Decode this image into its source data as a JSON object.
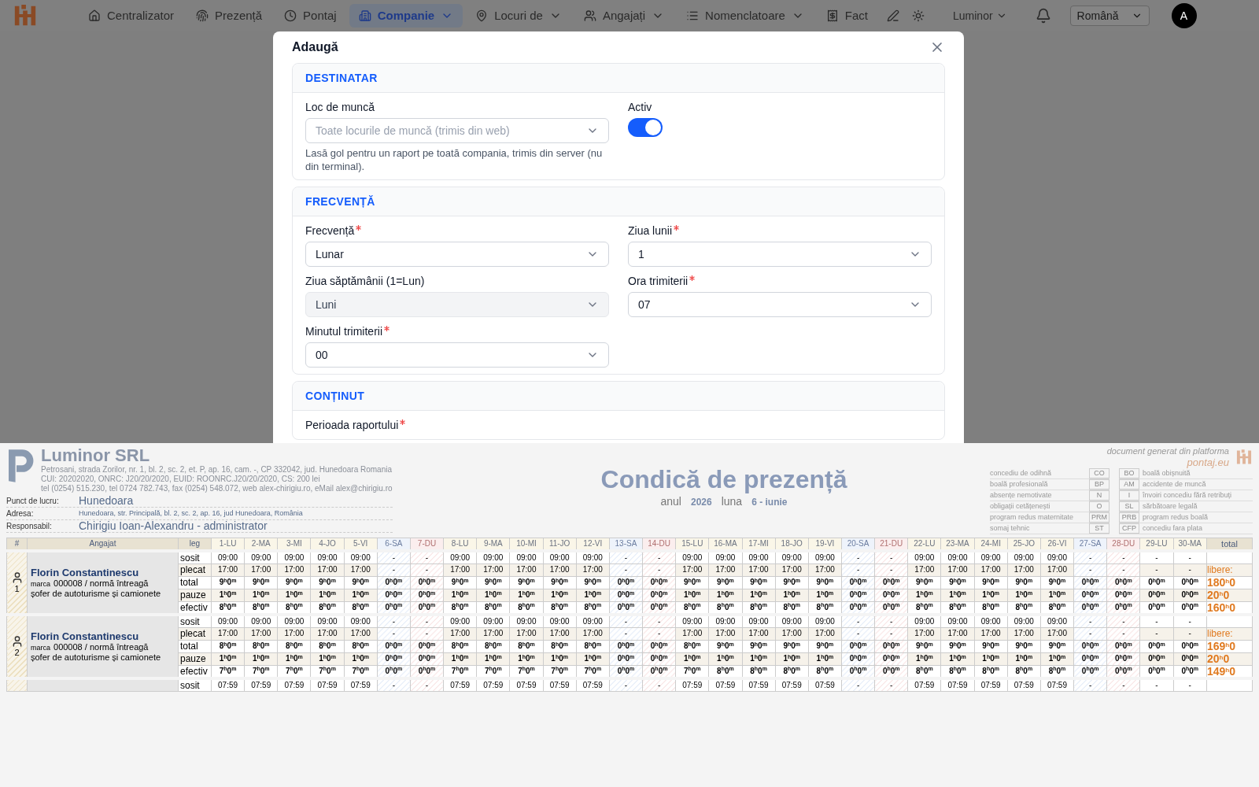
{
  "nav": {
    "items": [
      {
        "label": "Centralizator",
        "selected": false,
        "menu": false
      },
      {
        "label": "Prezență",
        "selected": false,
        "menu": false
      },
      {
        "label": "Pontaj",
        "selected": false,
        "menu": false
      },
      {
        "label": "Companie",
        "selected": true,
        "menu": true
      },
      {
        "label": "Locuri de",
        "selected": false,
        "menu": true
      },
      {
        "label": "Angajați",
        "selected": false,
        "menu": true
      },
      {
        "label": "Nomenclatoare",
        "selected": false,
        "menu": true
      },
      {
        "label": "Fact",
        "selected": false,
        "menu": false
      }
    ],
    "company": "Luminor",
    "language": "Română",
    "avatar": "A"
  },
  "modal": {
    "title": "Adaugă",
    "sections": [
      {
        "title": "DESTINATAR",
        "fields": [
          {
            "kind": "select",
            "label": "Loc de muncă",
            "required": false,
            "disabled": false,
            "placeholder": "Toate locurile de muncă (trimis din web)",
            "help": "Lasă gol pentru un raport pe toată compania, trimis din server (nu din terminal)."
          },
          {
            "kind": "toggle",
            "label": "Activ",
            "on": true
          }
        ]
      },
      {
        "title": "FRECVENȚĂ",
        "fields": [
          {
            "kind": "select",
            "label": "Frecvență",
            "required": true,
            "disabled": false,
            "value": "Lunar"
          },
          {
            "kind": "select",
            "label": "Ziua lunii",
            "required": true,
            "disabled": false,
            "value": "1"
          },
          {
            "kind": "select",
            "label": "Ziua săptămânii (1=Lun)",
            "required": false,
            "disabled": true,
            "value": "Luni"
          },
          {
            "kind": "select",
            "label": "Ora trimiterii",
            "required": true,
            "disabled": false,
            "value": "07"
          },
          {
            "kind": "select",
            "label": "Minutul trimiterii",
            "required": true,
            "disabled": false,
            "value": "00"
          }
        ]
      },
      {
        "title": "CONȚINUT",
        "fields": [
          {
            "kind": "label",
            "label": "Perioada raportului",
            "required": true
          }
        ]
      }
    ]
  },
  "document": {
    "company": {
      "name": "Luminor SRL",
      "lines": [
        "Petrosani, strada Zorilor, nr. 1, bl. 2, sc. 2, et. P, ap. 16, cam. -, CP 332042, jud. Hunedoara Romania",
        "CUI: 20202020, ONRC: J20/20/2020, EUID: ROONRC.J20/20/2020, CS: 200 lei",
        "tel (0254) 515.230, tel 0724 782.743, fax (0254) 548.072, web alex-chirigiu.ro, eMail alex@chirigiu.ro"
      ]
    },
    "info": [
      {
        "label": "Punct de lucru:",
        "value": "Hunedoara",
        "small": false
      },
      {
        "label": "Adresa:",
        "value": "Hunedoara, str. Principală, bl. 2, sc. 2, ap. 16, jud Hunedoara, România",
        "small": true
      },
      {
        "label": "Responsabil:",
        "value": "Chirigiu Ioan-Alexandru - administrator",
        "small": false
      }
    ],
    "title": "Condică de prezență",
    "year_label": "anul",
    "year": "2026",
    "month_label": "luna",
    "month": "6 - iunie",
    "platform_note": "document generat din platforma",
    "platform": "pontaj.eu",
    "legend_left": [
      {
        "label": "concediu de odihnă",
        "code": "CO"
      },
      {
        "label": "boală profesională",
        "code": "BP"
      },
      {
        "label": "absențe nemotivate",
        "code": "N"
      },
      {
        "label": "obligații cetățenești",
        "code": "O"
      },
      {
        "label": "program redus maternitate",
        "code": "PRM"
      },
      {
        "label": "somaj tehnic",
        "code": "ST"
      }
    ],
    "legend_right": [
      {
        "label": "boală obișnuită",
        "code": "BO"
      },
      {
        "label": "accidente de muncă",
        "code": "AM"
      },
      {
        "label": "învoiri concediu fără retribuți",
        "code": "I"
      },
      {
        "label": "sărbătoare legală",
        "code": "SL"
      },
      {
        "label": "program redus boală",
        "code": "PRB"
      },
      {
        "label": "concediu fara plata",
        "code": "CFP"
      }
    ]
  },
  "table": {
    "col_number": "#",
    "col_employee": "Angajat",
    "col_leg": "leg",
    "col_total": "total",
    "days": [
      {
        "label": "1-LU",
        "kind": "work"
      },
      {
        "label": "2-MA",
        "kind": "work"
      },
      {
        "label": "3-MI",
        "kind": "work"
      },
      {
        "label": "4-JO",
        "kind": "work"
      },
      {
        "label": "5-VI",
        "kind": "work"
      },
      {
        "label": "6-SA",
        "kind": "saturday"
      },
      {
        "label": "7-DU",
        "kind": "sunday"
      },
      {
        "label": "8-LU",
        "kind": "work"
      },
      {
        "label": "9-MA",
        "kind": "work"
      },
      {
        "label": "10-MI",
        "kind": "work"
      },
      {
        "label": "11-JO",
        "kind": "work"
      },
      {
        "label": "12-VI",
        "kind": "work"
      },
      {
        "label": "13-SA",
        "kind": "saturday"
      },
      {
        "label": "14-DU",
        "kind": "sunday"
      },
      {
        "label": "15-LU",
        "kind": "work"
      },
      {
        "label": "16-MA",
        "kind": "work"
      },
      {
        "label": "17-MI",
        "kind": "work"
      },
      {
        "label": "18-JO",
        "kind": "work"
      },
      {
        "label": "19-VI",
        "kind": "work"
      },
      {
        "label": "20-SA",
        "kind": "saturday"
      },
      {
        "label": "21-DU",
        "kind": "sunday"
      },
      {
        "label": "22-LU",
        "kind": "work"
      },
      {
        "label": "23-MA",
        "kind": "work"
      },
      {
        "label": "24-MI",
        "kind": "work"
      },
      {
        "label": "25-JO",
        "kind": "work"
      },
      {
        "label": "26-VI",
        "kind": "work"
      },
      {
        "label": "27-SA",
        "kind": "saturday"
      },
      {
        "label": "28-DU",
        "kind": "sunday"
      },
      {
        "label": "29-LU",
        "kind": "work"
      },
      {
        "label": "30-MA",
        "kind": "work"
      }
    ],
    "employees": [
      {
        "number": "1",
        "name": "Florin Constantinescu",
        "marca_label": "marca",
        "marca": "000008 / normă întreagă",
        "job": "șofer de autoturisme și camionete",
        "legs": [
          {
            "label": "sosit",
            "kind": "time",
            "values": [
              "09:00",
              "09:00",
              "09:00",
              "09:00",
              "09:00",
              "-",
              "-",
              "09:00",
              "09:00",
              "09:00",
              "09:00",
              "09:00",
              "-",
              "-",
              "09:00",
              "09:00",
              "09:00",
              "09:00",
              "09:00",
              "-",
              "-",
              "09:00",
              "09:00",
              "09:00",
              "09:00",
              "09:00",
              "-",
              "-",
              "-",
              "-"
            ]
          },
          {
            "label": "plecat",
            "kind": "time",
            "values": [
              "17:00",
              "17:00",
              "17:00",
              "17:00",
              "17:00",
              "-",
              "-",
              "17:00",
              "17:00",
              "17:00",
              "17:00",
              "17:00",
              "-",
              "-",
              "17:00",
              "17:00",
              "17:00",
              "17:00",
              "17:00",
              "-",
              "-",
              "17:00",
              "17:00",
              "17:00",
              "17:00",
              "17:00",
              "-",
              "-",
              "-",
              "-"
            ],
            "total": "libere:"
          },
          {
            "label": "total",
            "kind": "duration",
            "values": [
              "9$^{h}$0$^{m}$",
              "9$^{h}$0$^{m}$",
              "9$^{h}$0$^{m}$",
              "9$^{h}$0$^{m}$",
              "9$^{h}$0$^{m}$",
              "0$^{h}$0$^{m}$",
              "0$^{h}$0$^{m}$",
              "9$^{h}$0$^{m}$",
              "9$^{h}$0$^{m}$",
              "9$^{h}$0$^{m}$",
              "9$^{h}$0$^{m}$",
              "9$^{h}$0$^{m}$",
              "0$^{h}$0$^{m}$",
              "0$^{h}$0$^{m}$",
              "9$^{h}$0$^{m}$",
              "9$^{h}$0$^{m}$",
              "9$^{h}$0$^{m}$",
              "9$^{h}$0$^{m}$",
              "9$^{h}$0$^{m}$",
              "0$^{h}$0$^{m}$",
              "0$^{h}$0$^{m}$",
              "9$^{h}$0$^{m}$",
              "9$^{h}$0$^{m}$",
              "9$^{h}$0$^{m}$",
              "9$^{h}$0$^{m}$",
              "9$^{h}$0$^{m}$",
              "0$^{h}$0$^{m}$",
              "0$^{h}$0$^{m}$",
              "0$^{h}$0$^{m}$",
              "0$^{h}$0$^{m}$"
            ],
            "total": "180$^{h}$0"
          },
          {
            "label": "pauze",
            "kind": "duration",
            "values": [
              "1$^{h}$0$^{m}$",
              "1$^{h}$0$^{m}$",
              "1$^{h}$0$^{m}$",
              "1$^{h}$0$^{m}$",
              "1$^{h}$0$^{m}$",
              "0$^{h}$0$^{m}$",
              "0$^{h}$0$^{m}$",
              "1$^{h}$0$^{m}$",
              "1$^{h}$0$^{m}$",
              "1$^{h}$0$^{m}$",
              "1$^{h}$0$^{m}$",
              "1$^{h}$0$^{m}$",
              "0$^{h}$0$^{m}$",
              "0$^{h}$0$^{m}$",
              "1$^{h}$0$^{m}$",
              "1$^{h}$0$^{m}$",
              "1$^{h}$0$^{m}$",
              "1$^{h}$0$^{m}$",
              "1$^{h}$0$^{m}$",
              "0$^{h}$0$^{m}$",
              "0$^{h}$0$^{m}$",
              "1$^{h}$0$^{m}$",
              "1$^{h}$0$^{m}$",
              "1$^{h}$0$^{m}$",
              "1$^{h}$0$^{m}$",
              "1$^{h}$0$^{m}$",
              "0$^{h}$0$^{m}$",
              "0$^{h}$0$^{m}$",
              "0$^{h}$0$^{m}$",
              "0$^{h}$0$^{m}$"
            ],
            "total": "20$^{h}$0"
          },
          {
            "label": "efectiv",
            "kind": "duration",
            "values": [
              "8$^{h}$0$^{m}$",
              "8$^{h}$0$^{m}$",
              "8$^{h}$0$^{m}$",
              "8$^{h}$0$^{m}$",
              "8$^{h}$0$^{m}$",
              "0$^{h}$0$^{m}$",
              "0$^{h}$0$^{m}$",
              "8$^{h}$0$^{m}$",
              "8$^{h}$0$^{m}$",
              "8$^{h}$0$^{m}$",
              "8$^{h}$0$^{m}$",
              "8$^{h}$0$^{m}$",
              "0$^{h}$0$^{m}$",
              "0$^{h}$0$^{m}$",
              "8$^{h}$0$^{m}$",
              "8$^{h}$0$^{m}$",
              "8$^{h}$0$^{m}$",
              "8$^{h}$0$^{m}$",
              "8$^{h}$0$^{m}$",
              "0$^{h}$0$^{m}$",
              "0$^{h}$0$^{m}$",
              "8$^{h}$0$^{m}$",
              "8$^{h}$0$^{m}$",
              "8$^{h}$0$^{m}$",
              "8$^{h}$0$^{m}$",
              "8$^{h}$0$^{m}$",
              "0$^{h}$0$^{m}$",
              "0$^{h}$0$^{m}$",
              "0$^{h}$0$^{m}$",
              "0$^{h}$0$^{m}$"
            ],
            "total": "160$^{h}$0"
          }
        ]
      },
      {
        "number": "2",
        "name": "Florin Constantinescu",
        "marca_label": "marca",
        "marca": "000008 / normă întreagă",
        "job": "șofer de autoturisme și camionete",
        "legs": [
          {
            "label": "sosit",
            "kind": "time",
            "values": [
              "09:00",
              "09:00",
              "09:00",
              "09:00",
              "09:00",
              "-",
              "-",
              "09:00",
              "09:00",
              "09:00",
              "09:00",
              "09:00",
              "-",
              "-",
              "09:00",
              "09:00",
              "09:00",
              "09:00",
              "09:00",
              "-",
              "-",
              "09:00",
              "09:00",
              "09:00",
              "09:00",
              "09:00",
              "-",
              "-",
              "-",
              "-"
            ]
          },
          {
            "label": "plecat",
            "kind": "time",
            "values": [
              "17:00",
              "17:00",
              "17:00",
              "17:00",
              "17:00",
              "-",
              "-",
              "17:00",
              "17:00",
              "17:00",
              "17:00",
              "17:00",
              "-",
              "-",
              "17:00",
              "17:00",
              "17:00",
              "17:00",
              "17:00",
              "-",
              "-",
              "17:00",
              "17:00",
              "17:00",
              "17:00",
              "17:00",
              "-",
              "-",
              "-",
              "-"
            ],
            "total": "libere:"
          },
          {
            "label": "total",
            "kind": "duration",
            "values": [
              "8$^{h}$0$^{m}$",
              "8$^{h}$0$^{m}$",
              "8$^{h}$0$^{m}$",
              "8$^{h}$0$^{m}$",
              "8$^{h}$0$^{m}$",
              "0$^{h}$0$^{m}$",
              "0$^{h}$0$^{m}$",
              "8$^{h}$0$^{m}$",
              "8$^{h}$0$^{m}$",
              "8$^{h}$0$^{m}$",
              "8$^{h}$0$^{m}$",
              "8$^{h}$0$^{m}$",
              "0$^{h}$0$^{m}$",
              "0$^{h}$0$^{m}$",
              "8$^{h}$0$^{m}$",
              "9$^{h}$0$^{m}$",
              "9$^{h}$0$^{m}$",
              "9$^{h}$0$^{m}$",
              "9$^{h}$0$^{m}$",
              "0$^{h}$0$^{m}$",
              "0$^{h}$0$^{m}$",
              "9$^{h}$0$^{m}$",
              "9$^{h}$0$^{m}$",
              "9$^{h}$0$^{m}$",
              "9$^{h}$0$^{m}$",
              "9$^{h}$0$^{m}$",
              "0$^{h}$0$^{m}$",
              "0$^{h}$0$^{m}$",
              "0$^{h}$0$^{m}$",
              "0$^{h}$0$^{m}$"
            ],
            "total": "169$^{h}$0"
          },
          {
            "label": "pauze",
            "kind": "duration",
            "values": [
              "1$^{h}$0$^{m}$",
              "1$^{h}$0$^{m}$",
              "1$^{h}$0$^{m}$",
              "1$^{h}$0$^{m}$",
              "1$^{h}$0$^{m}$",
              "0$^{h}$0$^{m}$",
              "0$^{h}$0$^{m}$",
              "1$^{h}$0$^{m}$",
              "1$^{h}$0$^{m}$",
              "1$^{h}$0$^{m}$",
              "1$^{h}$0$^{m}$",
              "1$^{h}$0$^{m}$",
              "0$^{h}$0$^{m}$",
              "0$^{h}$0$^{m}$",
              "1$^{h}$0$^{m}$",
              "1$^{h}$0$^{m}$",
              "1$^{h}$0$^{m}$",
              "1$^{h}$0$^{m}$",
              "1$^{h}$0$^{m}$",
              "0$^{h}$0$^{m}$",
              "0$^{h}$0$^{m}$",
              "1$^{h}$0$^{m}$",
              "1$^{h}$0$^{m}$",
              "1$^{h}$0$^{m}$",
              "1$^{h}$0$^{m}$",
              "1$^{h}$0$^{m}$",
              "0$^{h}$0$^{m}$",
              "0$^{h}$0$^{m}$",
              "0$^{h}$0$^{m}$",
              "0$^{h}$0$^{m}$"
            ],
            "total": "20$^{h}$0"
          },
          {
            "label": "efectiv",
            "kind": "duration",
            "values": [
              "7$^{h}$0$^{m}$",
              "7$^{h}$0$^{m}$",
              "7$^{h}$0$^{m}$",
              "7$^{h}$0$^{m}$",
              "7$^{h}$0$^{m}$",
              "0$^{h}$0$^{m}$",
              "0$^{h}$0$^{m}$",
              "7$^{h}$0$^{m}$",
              "7$^{h}$0$^{m}$",
              "7$^{h}$0$^{m}$",
              "7$^{h}$0$^{m}$",
              "7$^{h}$0$^{m}$",
              "0$^{h}$0$^{m}$",
              "0$^{h}$0$^{m}$",
              "7$^{h}$0$^{m}$",
              "8$^{h}$0$^{m}$",
              "8$^{h}$0$^{m}$",
              "8$^{h}$0$^{m}$",
              "8$^{h}$0$^{m}$",
              "0$^{h}$0$^{m}$",
              "0$^{h}$0$^{m}$",
              "8$^{h}$0$^{m}$",
              "8$^{h}$0$^{m}$",
              "8$^{h}$0$^{m}$",
              "8$^{h}$0$^{m}$",
              "8$^{h}$0$^{m}$",
              "0$^{h}$0$^{m}$",
              "0$^{h}$0$^{m}$",
              "0$^{h}$0$^{m}$",
              "0$^{h}$0$^{m}$"
            ],
            "total": "149$^{h}$0"
          }
        ]
      },
      {
        "legs": [
          {
            "label": "sosit",
            "kind": "time",
            "values": [
              "07:59",
              "07:59",
              "07:59",
              "07:59",
              "07:59",
              "-",
              "-",
              "07:59",
              "07:59",
              "07:59",
              "07:59",
              "07:59",
              "-",
              "-",
              "07:59",
              "07:59",
              "07:59",
              "07:59",
              "07:59",
              "-",
              "-",
              "07:59",
              "07:59",
              "07:59",
              "07:59",
              "07:59",
              "-",
              "-",
              "-",
              "-"
            ]
          }
        ]
      }
    ]
  }
}
